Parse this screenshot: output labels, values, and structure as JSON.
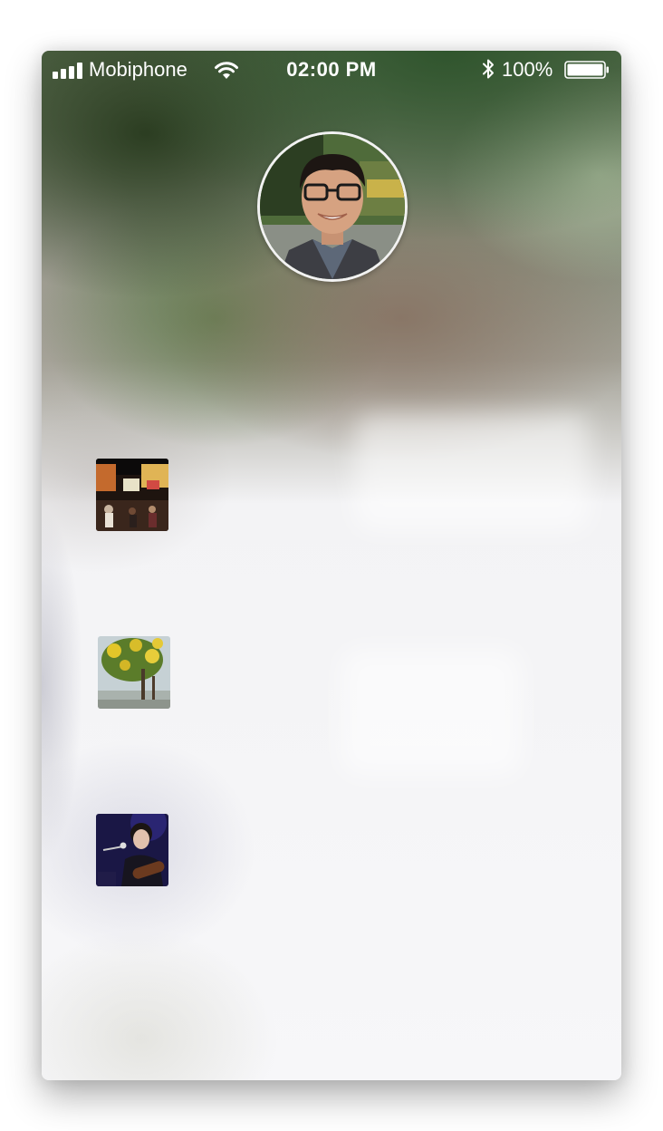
{
  "status_bar": {
    "carrier": "Mobiphone",
    "time": "02:00 PM",
    "battery_percent": "100%",
    "signal_bars": 4,
    "battery_level": 1.0,
    "icons": [
      "signal-bars-icon",
      "wifi-icon",
      "bluetooth-icon",
      "battery-icon"
    ]
  },
  "profile": {
    "avatar": "profile-avatar"
  },
  "feed": {
    "items": [
      {
        "thumbnail": "night-street-photo"
      },
      {
        "thumbnail": "yellow-flower-tree-photo"
      },
      {
        "thumbnail": "singer-with-guitar-photo"
      }
    ]
  },
  "colors": {
    "header_green": "#3e5a35",
    "background": "#f6f6f8",
    "status_text": "#ffffff"
  }
}
